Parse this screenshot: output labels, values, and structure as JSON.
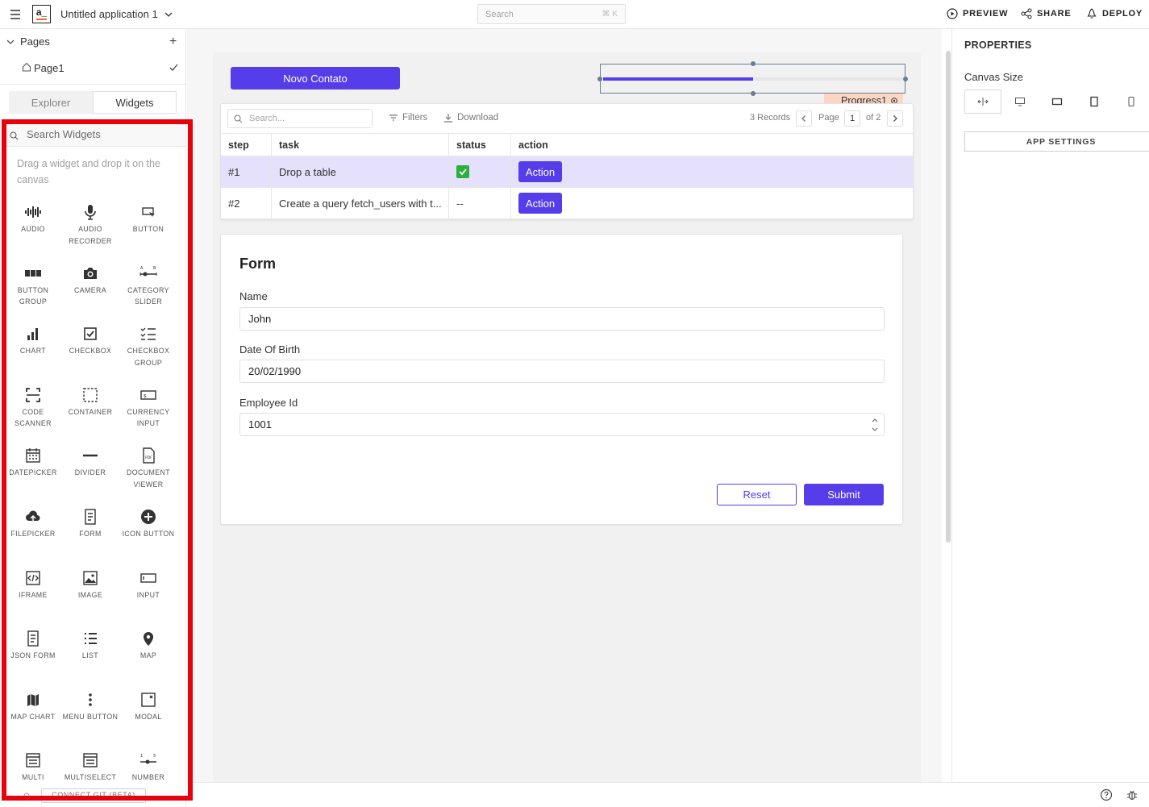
{
  "header": {
    "app_title": "Untitled application 1",
    "search_placeholder": "Search",
    "search_shortcut": "⌘ K",
    "preview": "PREVIEW",
    "share": "SHARE",
    "deploy": "DEPLOY",
    "logo_text": "a_"
  },
  "left": {
    "pages_label": "Pages",
    "pages_add": "+",
    "page_name": "Page1",
    "tab_explorer": "Explorer",
    "tab_widgets": "Widgets",
    "search_placeholder": "Search Widgets",
    "drag_hint": "Drag a widget and drop it on the canvas",
    "widgets": [
      {
        "label": "AUDIO",
        "icon": "audio-icon"
      },
      {
        "label": "AUDIO RECORDER",
        "icon": "microphone-icon"
      },
      {
        "label": "BUTTON",
        "icon": "button-icon"
      },
      {
        "label": "BUTTON GROUP",
        "icon": "button-group-icon"
      },
      {
        "label": "CAMERA",
        "icon": "camera-icon"
      },
      {
        "label": "CATEGORY SLIDER",
        "icon": "category-slider-icon"
      },
      {
        "label": "CHART",
        "icon": "chart-icon"
      },
      {
        "label": "CHECKBOX",
        "icon": "checkbox-icon"
      },
      {
        "label": "CHECKBOX GROUP",
        "icon": "checkbox-group-icon"
      },
      {
        "label": "CODE SCANNER",
        "icon": "code-scanner-icon"
      },
      {
        "label": "CONTAINER",
        "icon": "container-icon"
      },
      {
        "label": "CURRENCY INPUT",
        "icon": "currency-input-icon"
      },
      {
        "label": "DATEPICKER",
        "icon": "datepicker-icon"
      },
      {
        "label": "DIVIDER",
        "icon": "divider-icon"
      },
      {
        "label": "DOCUMENT VIEWER",
        "icon": "document-viewer-icon"
      },
      {
        "label": "FILEPICKER",
        "icon": "filepicker-icon"
      },
      {
        "label": "FORM",
        "icon": "form-icon"
      },
      {
        "label": "ICON BUTTON",
        "icon": "icon-button-icon"
      },
      {
        "label": "IFRAME",
        "icon": "iframe-icon"
      },
      {
        "label": "IMAGE",
        "icon": "image-icon"
      },
      {
        "label": "INPUT",
        "icon": "input-icon"
      },
      {
        "label": "JSON FORM",
        "icon": "json-form-icon"
      },
      {
        "label": "LIST",
        "icon": "list-icon"
      },
      {
        "label": "MAP",
        "icon": "map-pin-icon"
      },
      {
        "label": "MAP CHART",
        "icon": "map-chart-icon"
      },
      {
        "label": "MENU BUTTON",
        "icon": "menu-button-icon"
      },
      {
        "label": "MODAL",
        "icon": "modal-icon"
      },
      {
        "label": "MULTI",
        "icon": "multi-tree-icon"
      },
      {
        "label": "MULTISELECT",
        "icon": "multiselect-icon"
      },
      {
        "label": "NUMBER",
        "icon": "number-slider-icon"
      }
    ],
    "connect_git": "CONNECT GIT (BETA)"
  },
  "canvas": {
    "novo_button": "Novo Contato",
    "progress_tag": "Progress1",
    "progress_value": 0.5,
    "table": {
      "search_placeholder": "Search...",
      "filters": "Filters",
      "download": "Download",
      "records": "3 Records",
      "page_label": "Page",
      "page_current": "1",
      "page_of": "of 2",
      "columns": [
        "step",
        "task",
        "status",
        "action"
      ],
      "rows": [
        {
          "step": "#1",
          "task": "Drop a table",
          "status": "✅",
          "action": "Action"
        },
        {
          "step": "#2",
          "task": "Create a query fetch_users with t...",
          "status": "--",
          "action": "Action"
        }
      ]
    },
    "form": {
      "title": "Form",
      "name_label": "Name",
      "name_value": "John",
      "dob_label": "Date Of Birth",
      "dob_value": "20/02/1990",
      "emp_label": "Employee Id",
      "emp_value": "1001",
      "reset": "Reset",
      "submit": "Submit"
    }
  },
  "right": {
    "title": "PROPERTIES",
    "canvas_size": "Canvas Size",
    "app_settings": "APP SETTINGS"
  },
  "colors": {
    "accent": "#553de9",
    "highlight": "#e8000a",
    "tag": "#fcd5c5"
  }
}
